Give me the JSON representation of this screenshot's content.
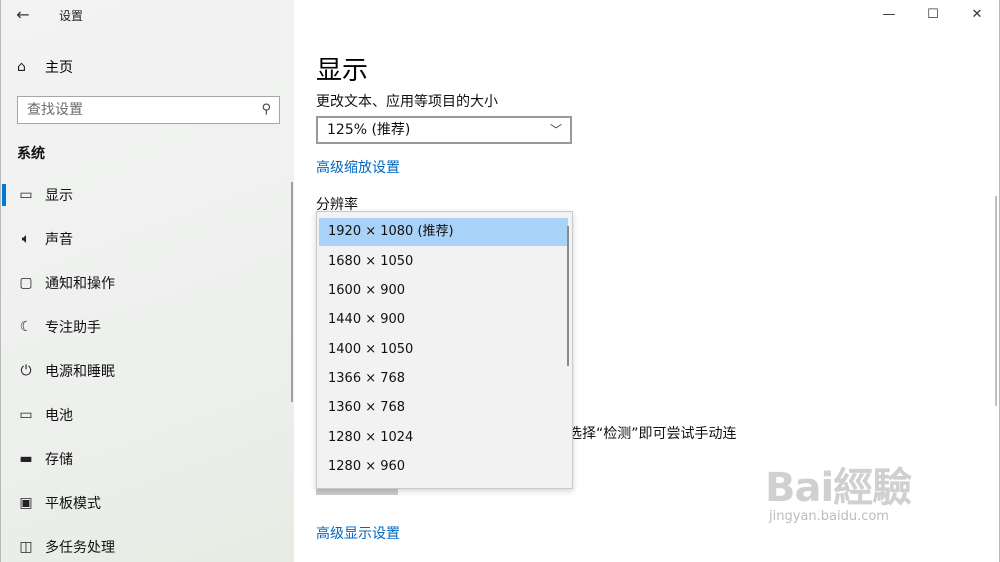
{
  "window": {
    "title": "设置",
    "back_icon": "←",
    "minimize_icon": "—",
    "maximize_icon": "☐",
    "close_icon": "✕"
  },
  "sidebar": {
    "home_label": "主页",
    "search_placeholder": "查找设置",
    "section_title": "系统",
    "items": [
      {
        "label": "显示",
        "icon": "monitor-icon",
        "active": true
      },
      {
        "label": "声音",
        "icon": "speaker-icon"
      },
      {
        "label": "通知和操作",
        "icon": "notification-icon"
      },
      {
        "label": "专注助手",
        "icon": "moon-icon"
      },
      {
        "label": "电源和睡眠",
        "icon": "power-icon"
      },
      {
        "label": "电池",
        "icon": "battery-icon"
      },
      {
        "label": "存储",
        "icon": "storage-icon"
      },
      {
        "label": "平板模式",
        "icon": "tablet-icon"
      },
      {
        "label": "多任务处理",
        "icon": "multitask-icon"
      }
    ]
  },
  "main": {
    "page_title": "显示",
    "scale_label": "更改文本、应用等项目的大小",
    "scale_value": "125% (推荐)",
    "advanced_scaling_link": "高级缩放设置",
    "resolution_label": "分辨率",
    "partial_text": "选择“检测”即可尝试手动连",
    "advanced_display_link": "高级显示设置"
  },
  "resolution_dropdown": {
    "selected_index": 0,
    "options": [
      "1920 × 1080 (推荐)",
      "1680 × 1050",
      "1600 × 900",
      "1440 × 900",
      "1400 × 1050",
      "1366 × 768",
      "1360 × 768",
      "1280 × 1024",
      "1280 × 960"
    ]
  },
  "watermark": {
    "logo": "Bai經驗",
    "sub": "jingyan.baidu.com"
  },
  "colors": {
    "accent": "#0078d7",
    "link": "#0067c0",
    "selected": "#a9d2f8"
  }
}
